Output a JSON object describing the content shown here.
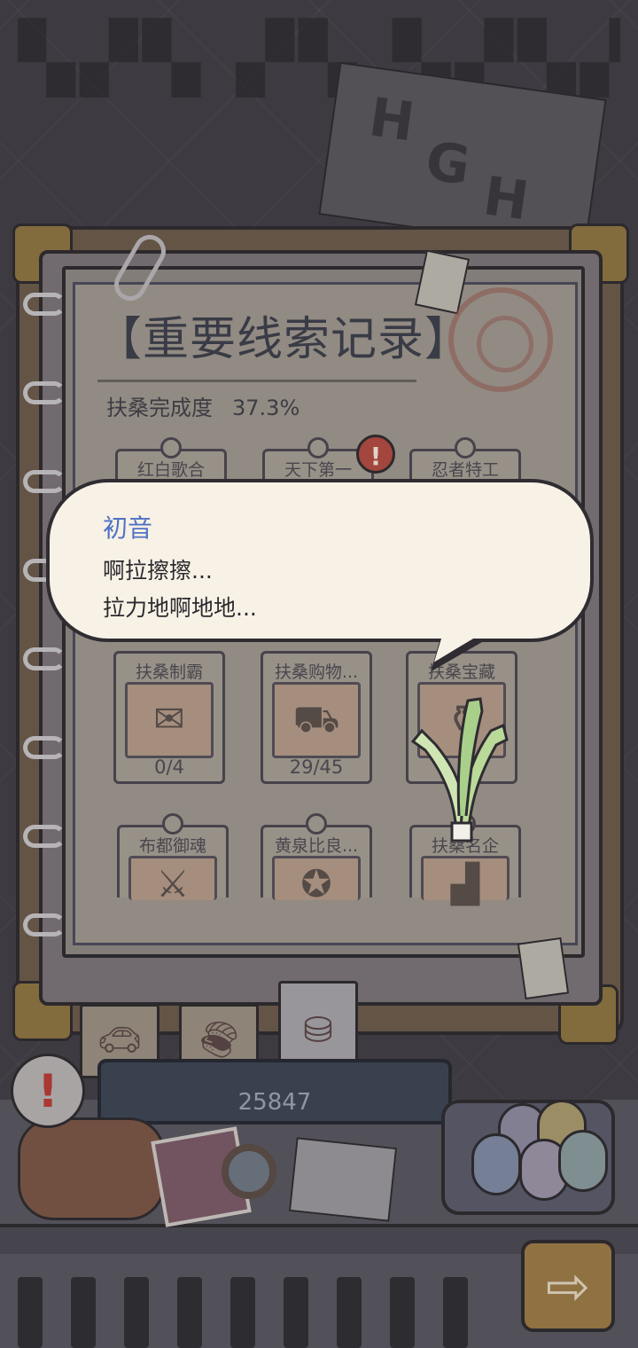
{
  "record": {
    "title": "【重要线索记录】",
    "progress_label": "扶桑完成度",
    "progress_value": "37.3%"
  },
  "cards_row1": [
    {
      "label": "红白歌合"
    },
    {
      "label": "天下第一"
    },
    {
      "label": "忍者特工"
    }
  ],
  "cards_row2": [
    {
      "label": "扶桑制霸",
      "icon": "stamp-icon",
      "count": "0/4"
    },
    {
      "label": "扶桑购物...",
      "icon": "cart-icon",
      "count": "29/45"
    },
    {
      "label": "扶桑宝藏",
      "icon": "treasure-icon",
      "count": ""
    }
  ],
  "cards_row3": [
    {
      "label": "布都御魂",
      "icon": "sword-icon"
    },
    {
      "label": "黄泉比良...",
      "icon": "emblem-icon"
    },
    {
      "label": "扶桑名企",
      "icon": "building-icon"
    }
  ],
  "dialog": {
    "speaker": "初音",
    "line1": "啊拉擦擦...",
    "line2": "拉力地啊地地..."
  },
  "tabs": [
    {
      "icon": "car-icon"
    },
    {
      "icon": "food-icon"
    },
    {
      "icon": "chest-icon"
    }
  ],
  "currency": {
    "value": "25847"
  },
  "colors": {
    "speaker": "#4f72c4",
    "alert_red": "#b24a40",
    "dialog_bg": "#f8f1e5"
  }
}
